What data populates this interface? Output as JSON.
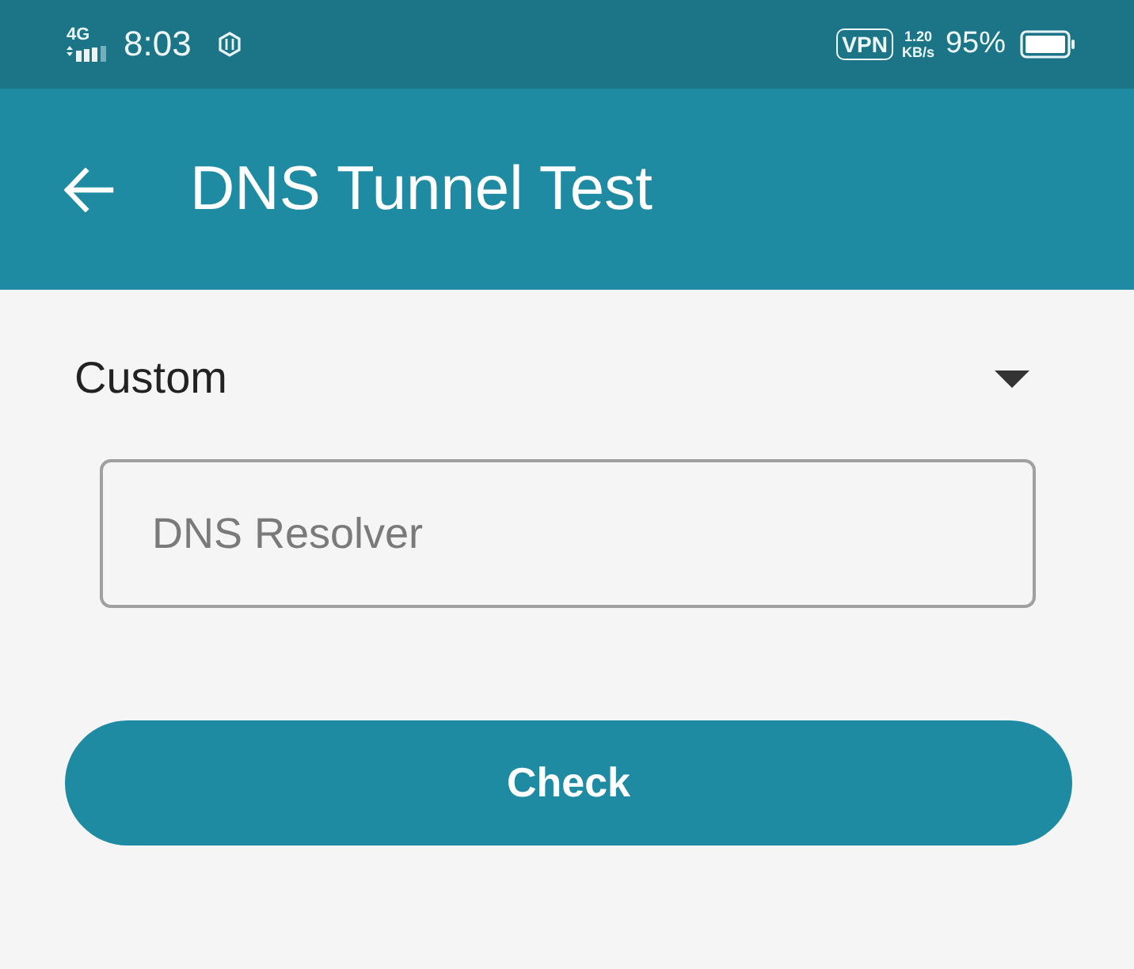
{
  "status_bar": {
    "network": "4G",
    "time": "8:03",
    "vpn": "VPN",
    "speed_value": "1.20",
    "speed_unit": "KB/s",
    "battery_percent": "95%"
  },
  "app_bar": {
    "title": "DNS Tunnel Test"
  },
  "dropdown": {
    "value": "Custom"
  },
  "resolver_field": {
    "placeholder": "DNS Resolver"
  },
  "check_button": {
    "label": "Check"
  }
}
